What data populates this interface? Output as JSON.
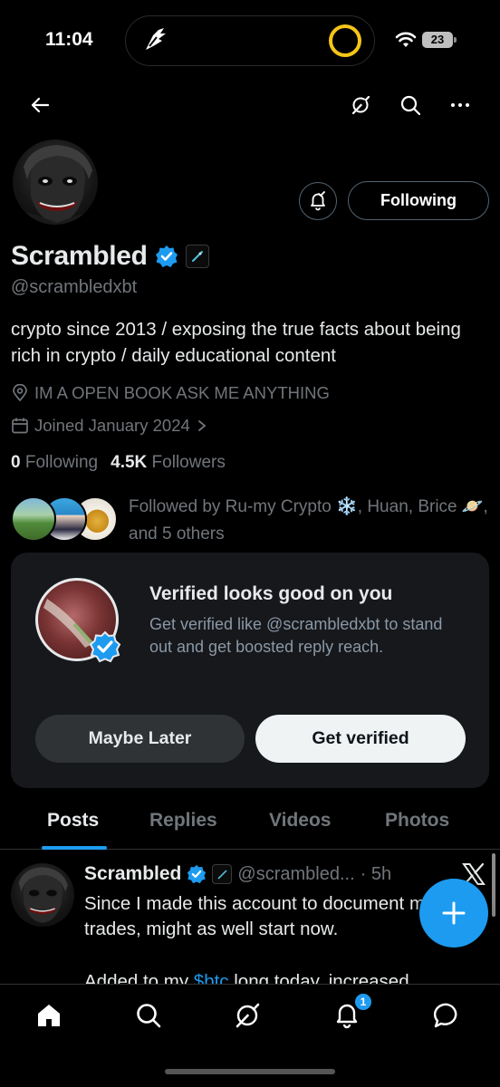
{
  "status_bar": {
    "time": "11:04",
    "battery": "23"
  },
  "profile": {
    "display_name": "Scrambled",
    "handle": "@scrambledxbt",
    "bio": "crypto since 2013 / exposing the true facts about being rich in crypto / daily educational content",
    "location": "IM A OPEN BOOK ASK ME ANYTHING",
    "joined": "Joined January 2024",
    "following_count": "0",
    "following_label": "Following",
    "followers_count": "4.5K",
    "followers_label": "Followers",
    "followed_by": "Followed by Ru-my Crypto ❄️, Huan, Brice 🪐, and 5 others",
    "follow_button": "Following"
  },
  "verify_card": {
    "title": "Verified looks good on you",
    "subtitle": "Get verified like @scrambledxbt to stand out and get boosted reply reach.",
    "maybe_label": "Maybe Later",
    "get_label": "Get verified"
  },
  "tabs": [
    {
      "label": "Posts",
      "active": true
    },
    {
      "label": "Replies",
      "active": false
    },
    {
      "label": "Videos",
      "active": false
    },
    {
      "label": "Photos",
      "active": false
    }
  ],
  "post": {
    "name": "Scrambled",
    "handle": "@scrambled...",
    "time": "· 5h",
    "text": "Since I made this account to document my trades, might as well start now.",
    "text2_prefix": "Added to my ",
    "cashtag": "$btc",
    "text2_suffix": " long today, increased"
  },
  "bottom_nav": {
    "notification_count": "1"
  },
  "colors": {
    "accent": "#1d9bf0",
    "background": "#000000",
    "card": "#16181c",
    "muted": "#71767b"
  }
}
